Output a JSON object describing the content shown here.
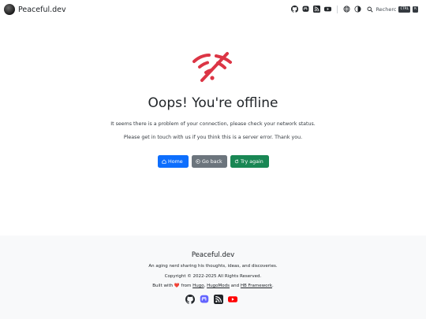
{
  "header": {
    "brand": "Peaceful.dev",
    "icons": [
      "github-icon",
      "mastodon-icon",
      "rss-icon",
      "youtube-icon",
      "language-icon",
      "theme-toggle-icon"
    ],
    "search": {
      "placeholder": "Rechercher",
      "kbd_ctrl": "CTRL",
      "kbd_key": "K"
    }
  },
  "main": {
    "title": "Oops! You're offline",
    "message1": "It seems there is a problem of your connection, please check your network status.",
    "message2": "Please get in touch with us if you think this is a server error. Thank you.",
    "buttons": {
      "home": "Home",
      "back": "Go back",
      "retry": "Try again"
    }
  },
  "footer": {
    "title": "Peaceful.dev",
    "tagline": "An aging nerd sharing his thoughts, ideas, and discoveries.",
    "copyright": "Copyright © 2022-2025 All Rights Reserved.",
    "built_prefix": "Built with",
    "built_from": "from",
    "built_and": "and",
    "link_hugo": "Hugo",
    "link_hugomods": "HugoMods",
    "link_hb": "HB Framework",
    "social": [
      "github-icon",
      "mastodon-icon",
      "rss-icon",
      "youtube-icon"
    ]
  },
  "colors": {
    "primary": "#0d6efd",
    "secondary": "#6c757d",
    "success": "#198754",
    "danger": "#dc3545",
    "footer_bg": "#f8f9fa"
  }
}
